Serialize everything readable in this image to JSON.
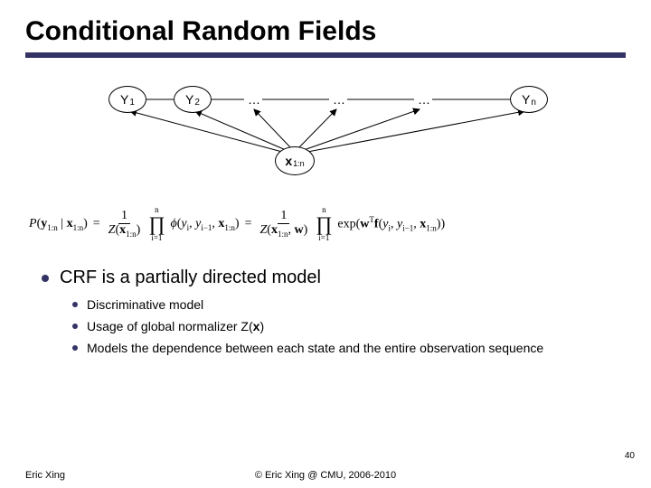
{
  "title": "Conditional Random Fields",
  "graph": {
    "y1": {
      "base": "Y",
      "sub": "1"
    },
    "y2": {
      "base": "Y",
      "sub": "2"
    },
    "dots": "…",
    "yn": {
      "base": "Y",
      "sub": "n"
    },
    "x": {
      "base": "x",
      "sub": "1:n"
    }
  },
  "formula": {
    "lhs_P": "P",
    "lhs_args": "(",
    "y": "y",
    "y_sub": "1:n",
    "bar": " | ",
    "x": "x",
    "x_sub": "1:n",
    "close": ")",
    "eq": "=",
    "one": "1",
    "Z": "Z",
    "Zarg_open": "(",
    "Zarg_close": ")",
    "prod_top": "n",
    "prod_bot": "i=1",
    "phi": "ϕ",
    "phi_args_open": "(",
    "yi": "y",
    "yi_sub": "i",
    "comma": ", ",
    "yim1": "y",
    "yim1_sub": "i−1",
    "phi_args_close": ")",
    "Z2arg_open": "(",
    "w": "w",
    "Z2arg_close": ")",
    "exp": "exp",
    "wTf": "w",
    "T": "T",
    "f": "f",
    "fargs_open": "(",
    "fargs_close": ")"
  },
  "bullets": {
    "main": "CRF is a partially directed model",
    "subs": [
      "Discriminative model",
      {
        "pre": "Usage of global normalizer Z(",
        "xvar": "x",
        "post": ")"
      },
      "Models the dependence between each state and the entire observation sequence"
    ]
  },
  "slidenum": "40",
  "footer": {
    "left": "Eric Xing",
    "center": "© Eric Xing @ CMU, 2006-2010"
  }
}
